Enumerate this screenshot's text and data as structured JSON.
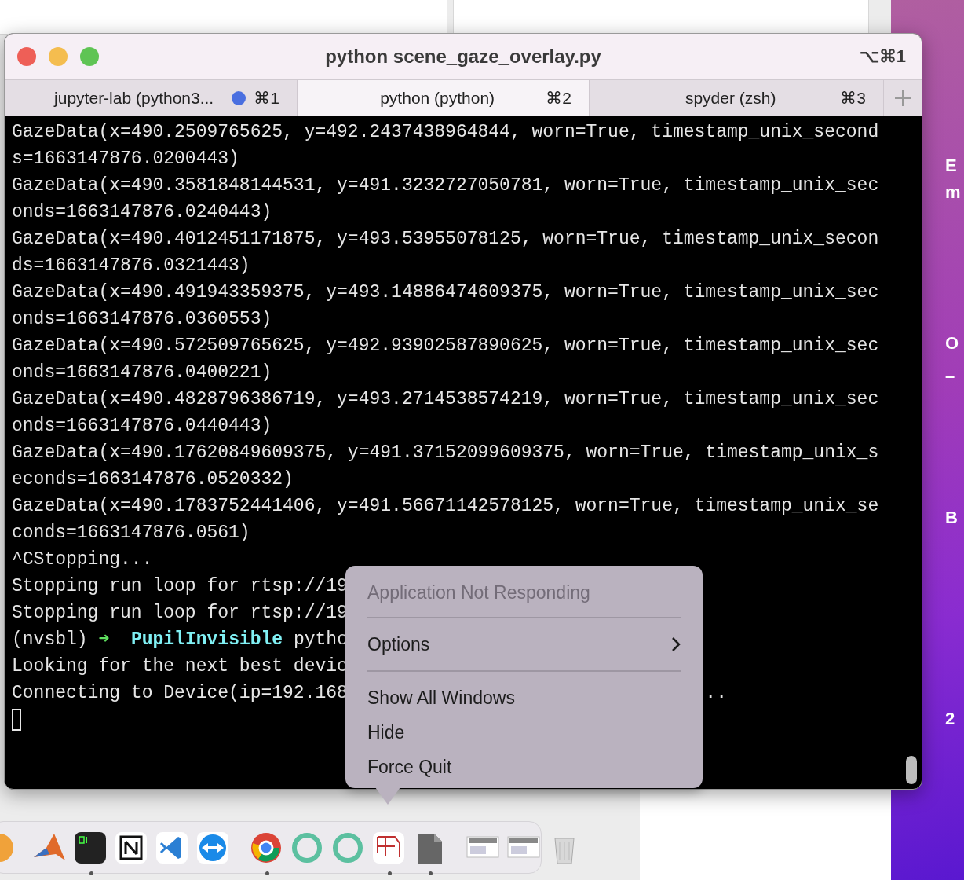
{
  "desktop_labels": [
    "E",
    "m",
    "O",
    "–",
    "B",
    "2"
  ],
  "window": {
    "title": "python scene_gaze_overlay.py",
    "shortcut": "⌥⌘1"
  },
  "tabs": [
    {
      "label": "jupyter-lab (python3...",
      "shortcut": "⌘1",
      "selected": false,
      "activity": true
    },
    {
      "label": "python (python)",
      "shortcut": "⌘2",
      "selected": true,
      "activity": false
    },
    {
      "label": "spyder (zsh)",
      "shortcut": "⌘3",
      "selected": false,
      "activity": false
    }
  ],
  "terminal": {
    "lines": [
      {
        "kind": "plain",
        "text": "GazeData(x=490.2509765625, y=492.2437438964844, worn=True, timestamp_unix_second"
      },
      {
        "kind": "plain",
        "text": "s=1663147876.0200443)"
      },
      {
        "kind": "plain",
        "text": "GazeData(x=490.3581848144531, y=491.3232727050781, worn=True, timestamp_unix_sec"
      },
      {
        "kind": "plain",
        "text": "onds=1663147876.0240443)"
      },
      {
        "kind": "plain",
        "text": "GazeData(x=490.4012451171875, y=493.53955078125, worn=True, timestamp_unix_secon"
      },
      {
        "kind": "plain",
        "text": "ds=1663147876.0321443)"
      },
      {
        "kind": "plain",
        "text": "GazeData(x=490.491943359375, y=493.14886474609375, worn=True, timestamp_unix_sec"
      },
      {
        "kind": "plain",
        "text": "onds=1663147876.0360553)"
      },
      {
        "kind": "plain",
        "text": "GazeData(x=490.572509765625, y=492.93902587890625, worn=True, timestamp_unix_sec"
      },
      {
        "kind": "plain",
        "text": "onds=1663147876.0400221)"
      },
      {
        "kind": "plain",
        "text": "GazeData(x=490.4828796386719, y=493.2714538574219, worn=True, timestamp_unix_sec"
      },
      {
        "kind": "plain",
        "text": "onds=1663147876.0440443)"
      },
      {
        "kind": "plain",
        "text": "GazeData(x=490.17620849609375, y=491.37152099609375, worn=True, timestamp_unix_s"
      },
      {
        "kind": "plain",
        "text": "econds=1663147876.0520332)"
      },
      {
        "kind": "plain",
        "text": "GazeData(x=490.1783752441406, y=491.56671142578125, worn=True, timestamp_unix_se"
      },
      {
        "kind": "plain",
        "text": "conds=1663147876.0561)"
      },
      {
        "kind": "plain",
        "text": "^CStopping..."
      },
      {
        "kind": "plain",
        "text": "Stopping run loop for rtsp://19"
      },
      {
        "kind": "plain",
        "text": "Stopping run loop for rtsp://19"
      },
      {
        "kind": "prompt",
        "env": "(nvsbl)",
        "arrow": "➜",
        "dir": "PupilInvisible",
        "command": "pytho"
      },
      {
        "kind": "plain",
        "text": "Looking for the next best devic"
      },
      {
        "kind": "plain",
        "text": "Connecting to Device(ip=192.168",
        "tail": ".."
      },
      {
        "kind": "cursor"
      }
    ]
  },
  "dock_menu": {
    "items": [
      {
        "kind": "header",
        "label": "Application Not Responding"
      },
      {
        "kind": "separator"
      },
      {
        "kind": "submenu",
        "label": "Options"
      },
      {
        "kind": "separator"
      },
      {
        "kind": "item",
        "label": "Show All Windows"
      },
      {
        "kind": "item",
        "label": "Hide"
      },
      {
        "kind": "item",
        "label": "Force Quit"
      }
    ]
  },
  "dock": {
    "items": [
      {
        "kind": "flame",
        "running": false
      },
      {
        "kind": "peak",
        "running": false
      },
      {
        "kind": "terminal",
        "running": true
      },
      {
        "kind": "letter",
        "running": false
      },
      {
        "kind": "code",
        "running": false
      },
      {
        "kind": "arrows",
        "running": false
      },
      {
        "kind": "divider"
      },
      {
        "kind": "globe",
        "running": true
      },
      {
        "kind": "ring",
        "running": false
      },
      {
        "kind": "ring",
        "running": false
      },
      {
        "kind": "grid",
        "running": true
      },
      {
        "kind": "file",
        "running": true
      },
      {
        "kind": "divider"
      },
      {
        "kind": "window",
        "running": false
      },
      {
        "kind": "window",
        "running": false
      },
      {
        "kind": "trash",
        "running": false
      }
    ]
  }
}
